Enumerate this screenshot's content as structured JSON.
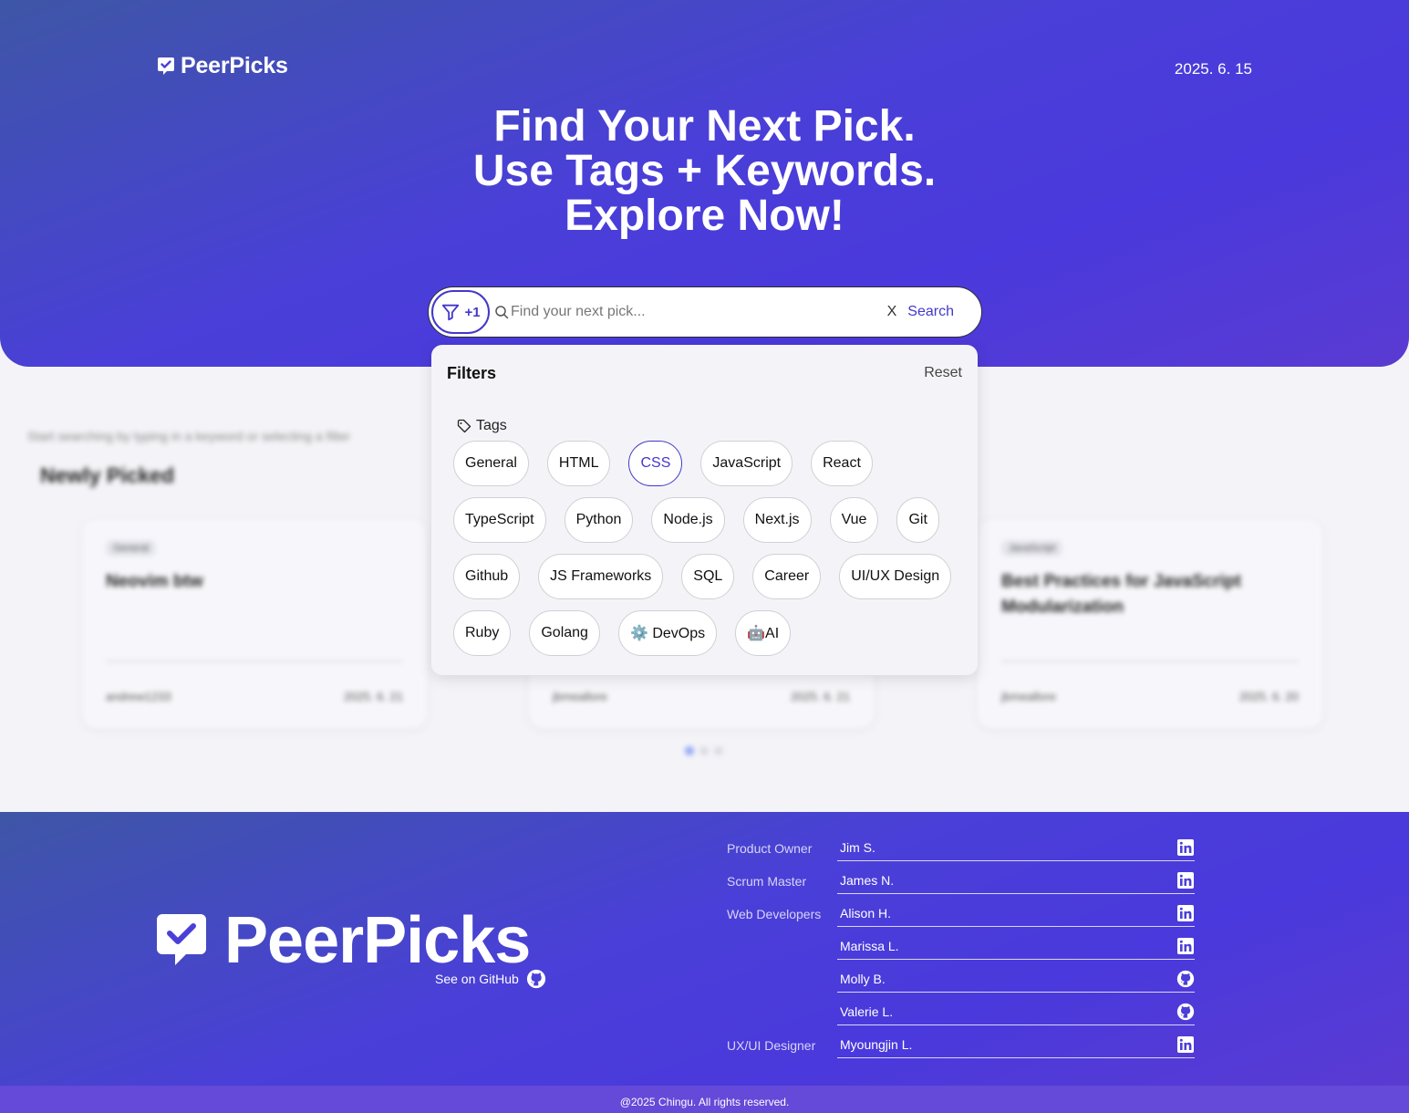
{
  "header": {
    "logo_text": "PeerPicks",
    "date": "2025. 6. 15"
  },
  "hero": {
    "headline_lines": [
      "Find Your Next Pick.",
      "Use Tags + Keywords.",
      "Explore Now!"
    ]
  },
  "search": {
    "filter_count": "+1",
    "placeholder": "Find your next pick...",
    "value": "",
    "clear_label": "X",
    "search_label": "Search"
  },
  "filters": {
    "title": "Filters",
    "reset_label": "Reset",
    "tags_label": "Tags",
    "tags": [
      [
        "General",
        "HTML",
        "CSS",
        "JavaScript",
        "React"
      ],
      [
        "TypeScript",
        "Python",
        "Node.js",
        "Next.js",
        "Vue",
        "Git"
      ],
      [
        "Github",
        "JS Frameworks",
        "SQL",
        "Career",
        "UI/UX Design"
      ],
      [
        "Ruby",
        "Golang",
        "⚙️ DevOps",
        "🤖AI"
      ]
    ],
    "selected_tag": "CSS"
  },
  "main": {
    "hint": "Start searching by typing in a keyword or selecting a filter",
    "section_title": "Newly Picked",
    "cards": [
      {
        "tag": "General",
        "title": "Neovim btw",
        "author": "andrew1233",
        "date": "2025. 6. 21"
      },
      {
        "tag": "",
        "title": "",
        "author": "jbmeallore",
        "date": "2025. 6. 21"
      },
      {
        "tag": "JavaScript",
        "title": "Best Practices for JavaScript Modularization",
        "author": "jbmeallore",
        "date": "2025. 6. 20"
      }
    ],
    "carousel_pages": 3,
    "carousel_active": 1
  },
  "footer": {
    "logo_text": "PeerPicks",
    "github_label": "See on GitHub",
    "team": [
      {
        "role": "Product Owner",
        "name": "Jim S.",
        "link": "linkedin-icon"
      },
      {
        "role": "Scrum Master",
        "name": "James N.",
        "link": "linkedin-icon"
      },
      {
        "role": "Web Developers",
        "name": "Alison H.",
        "link": "linkedin-icon"
      },
      {
        "role": "",
        "name": "Marissa L.",
        "link": "linkedin-icon"
      },
      {
        "role": "",
        "name": "Molly B.",
        "link": "github-icon"
      },
      {
        "role": "",
        "name": "Valerie L.",
        "link": "github-icon"
      },
      {
        "role": "UX/UI Designer",
        "name": "Myoungjin L.",
        "link": "linkedin-icon"
      }
    ],
    "copyright": "@2025 Chingu. All rights reserved."
  },
  "colors": {
    "brand": "#4a3fd8",
    "accent": "#4338ca",
    "page_bg": "#f4f4f8"
  }
}
